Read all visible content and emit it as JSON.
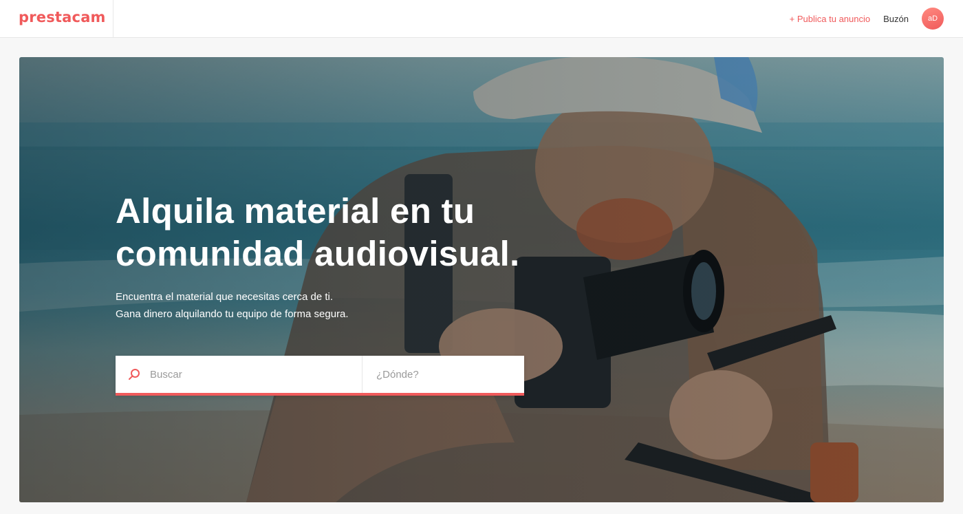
{
  "header": {
    "logo": "prestacam",
    "publish_label": "+ Publica tu anuncio",
    "inbox_label": "Buzón",
    "avatar_initials": "aD"
  },
  "hero": {
    "title_line1": "Alquila material en tu",
    "title_line2": "comunidad audiovisual.",
    "subtitle_line1": "Encuentra el material que necesitas cerca de ti.",
    "subtitle_line2": "Gana dinero alquilando tu equipo de forma segura.",
    "image": "photographer-with-camera-on-beach"
  },
  "search": {
    "icon": "search-icon",
    "query_placeholder": "Buscar",
    "query_value": "",
    "location_placeholder": "¿Dónde?",
    "location_value": ""
  },
  "colors": {
    "brand": "#f05a5b",
    "text": "#333333",
    "placeholder": "#9a9a9a"
  }
}
